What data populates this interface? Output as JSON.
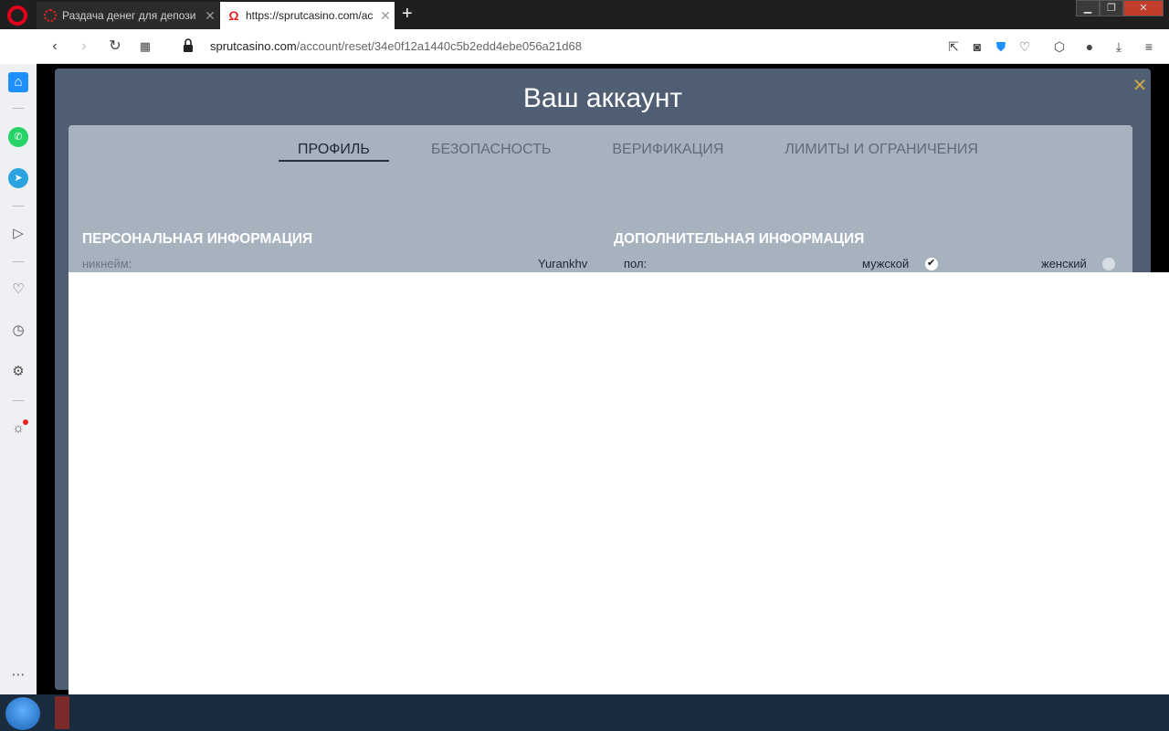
{
  "browser": {
    "tabs": [
      {
        "title": "Раздача денег для депози"
      },
      {
        "title": "https://sprutcasino.com/ac"
      }
    ],
    "url_domain": "sprutcasino.com",
    "url_path": "/account/reset/34e0f12a1440c5b2edd4ebe056a21d68"
  },
  "modal": {
    "title": "Ваш аккаунт",
    "tabs": [
      {
        "label": "ПРОФИЛЬ"
      },
      {
        "label": "БЕЗОПАСНОСТЬ"
      },
      {
        "label": "ВЕРИФИКАЦИЯ"
      },
      {
        "label": "ЛИМИТЫ И ОГРАНИЧЕНИЯ"
      }
    ],
    "personal": {
      "title": "ПЕРСОНАЛЬНАЯ ИНФОРМАЦИЯ",
      "nickname_label": "никнейм:",
      "nickname_value": "Yurankhv"
    },
    "additional": {
      "title": "ДОПОЛНИТЕЛЬНАЯ ИНФОРМАЦИЯ",
      "gender_label": "пол:",
      "male_label": "мужской",
      "female_label": "женский",
      "selected": "мужской"
    }
  },
  "icons": {
    "accent": "#1e90ff",
    "modal_bg": "#505e73",
    "panel_bg": "#a7b2bf"
  }
}
